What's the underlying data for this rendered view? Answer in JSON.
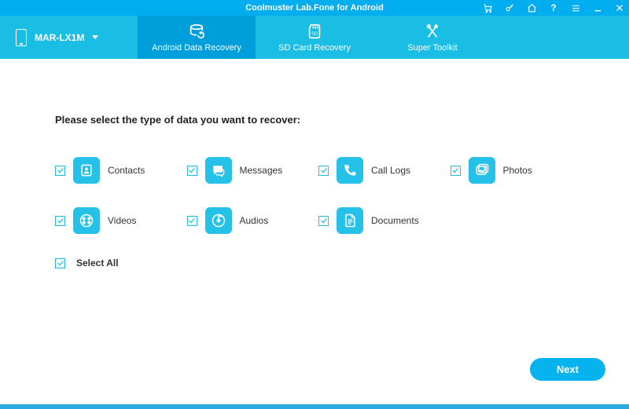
{
  "titlebar": {
    "title": "Coolmuster Lab.Fone for Android"
  },
  "device": {
    "name": "MAR-LX1M"
  },
  "nav": {
    "items": [
      {
        "label": "Android Data Recovery",
        "active": true
      },
      {
        "label": "SD Card Recovery",
        "active": false
      },
      {
        "label": "Super Toolkit",
        "active": false
      }
    ]
  },
  "content": {
    "prompt": "Please select the type of data you want to recover:",
    "types": [
      {
        "label": "Contacts",
        "checked": true,
        "icon": "contacts"
      },
      {
        "label": "Messages",
        "checked": true,
        "icon": "messages"
      },
      {
        "label": "Call Logs",
        "checked": true,
        "icon": "calllogs"
      },
      {
        "label": "Photos",
        "checked": true,
        "icon": "photos"
      },
      {
        "label": "Videos",
        "checked": true,
        "icon": "videos"
      },
      {
        "label": "Audios",
        "checked": true,
        "icon": "audios"
      },
      {
        "label": "Documents",
        "checked": true,
        "icon": "documents"
      }
    ],
    "selectAll": {
      "label": "Select All",
      "checked": true
    },
    "nextLabel": "Next"
  },
  "colors": {
    "accent": "#1abde4",
    "accentDark": "#009edb",
    "button": "#06b3ee"
  }
}
